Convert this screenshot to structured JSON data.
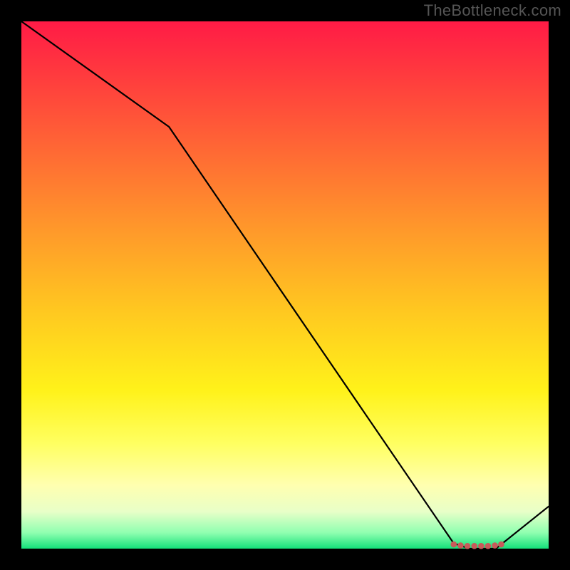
{
  "attribution": "TheBottleneck.com",
  "chart_data": {
    "type": "line",
    "title": "",
    "xlabel": "",
    "ylabel": "",
    "xlim": [
      0,
      100
    ],
    "ylim": [
      0,
      100
    ],
    "series": [
      {
        "name": "bottleneck-curve",
        "x": [
          0,
          28,
          82,
          85,
          90,
          100
        ],
        "values": [
          100,
          80,
          1,
          0,
          0,
          8
        ]
      }
    ],
    "markers": {
      "name": "optimal-range",
      "x": [
        82,
        83.3,
        84.6,
        85.9,
        87.2,
        88.5,
        89.8,
        91
      ],
      "values": [
        0.8,
        0.6,
        0.5,
        0.5,
        0.5,
        0.5,
        0.6,
        0.8
      ]
    },
    "background_gradient": {
      "top": "#ff1b46",
      "mid1": "#ff9a2a",
      "mid2": "#fff21a",
      "bottom": "#14e07a"
    }
  }
}
